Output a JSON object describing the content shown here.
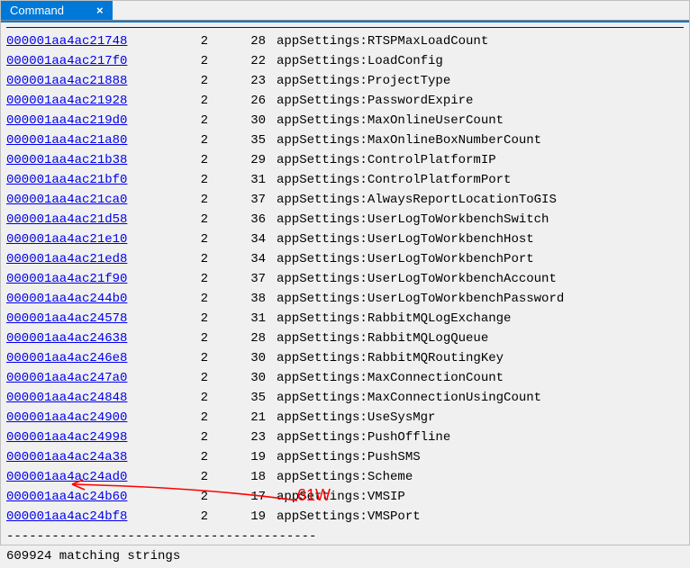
{
  "window": {
    "title": "Command"
  },
  "rows": [
    {
      "addr": "000001aa4ac21748",
      "ref": 2,
      "len": 28,
      "str": "appSettings:RTSPMaxLoadCount"
    },
    {
      "addr": "000001aa4ac217f0",
      "ref": 2,
      "len": 22,
      "str": "appSettings:LoadConfig"
    },
    {
      "addr": "000001aa4ac21888",
      "ref": 2,
      "len": 23,
      "str": "appSettings:ProjectType"
    },
    {
      "addr": "000001aa4ac21928",
      "ref": 2,
      "len": 26,
      "str": "appSettings:PasswordExpire"
    },
    {
      "addr": "000001aa4ac219d0",
      "ref": 2,
      "len": 30,
      "str": "appSettings:MaxOnlineUserCount"
    },
    {
      "addr": "000001aa4ac21a80",
      "ref": 2,
      "len": 35,
      "str": "appSettings:MaxOnlineBoxNumberCount"
    },
    {
      "addr": "000001aa4ac21b38",
      "ref": 2,
      "len": 29,
      "str": "appSettings:ControlPlatformIP"
    },
    {
      "addr": "000001aa4ac21bf0",
      "ref": 2,
      "len": 31,
      "str": "appSettings:ControlPlatformPort"
    },
    {
      "addr": "000001aa4ac21ca0",
      "ref": 2,
      "len": 37,
      "str": "appSettings:AlwaysReportLocationToGIS"
    },
    {
      "addr": "000001aa4ac21d58",
      "ref": 2,
      "len": 36,
      "str": "appSettings:UserLogToWorkbenchSwitch"
    },
    {
      "addr": "000001aa4ac21e10",
      "ref": 2,
      "len": 34,
      "str": "appSettings:UserLogToWorkbenchHost"
    },
    {
      "addr": "000001aa4ac21ed8",
      "ref": 2,
      "len": 34,
      "str": "appSettings:UserLogToWorkbenchPort"
    },
    {
      "addr": "000001aa4ac21f90",
      "ref": 2,
      "len": 37,
      "str": "appSettings:UserLogToWorkbenchAccount"
    },
    {
      "addr": "000001aa4ac244b0",
      "ref": 2,
      "len": 38,
      "str": "appSettings:UserLogToWorkbenchPassword"
    },
    {
      "addr": "000001aa4ac24578",
      "ref": 2,
      "len": 31,
      "str": "appSettings:RabbitMQLogExchange"
    },
    {
      "addr": "000001aa4ac24638",
      "ref": 2,
      "len": 28,
      "str": "appSettings:RabbitMQLogQueue"
    },
    {
      "addr": "000001aa4ac246e8",
      "ref": 2,
      "len": 30,
      "str": "appSettings:RabbitMQRoutingKey"
    },
    {
      "addr": "000001aa4ac247a0",
      "ref": 2,
      "len": 30,
      "str": "appSettings:MaxConnectionCount"
    },
    {
      "addr": "000001aa4ac24848",
      "ref": 2,
      "len": 35,
      "str": "appSettings:MaxConnectionUsingCount"
    },
    {
      "addr": "000001aa4ac24900",
      "ref": 2,
      "len": 21,
      "str": "appSettings:UseSysMgr"
    },
    {
      "addr": "000001aa4ac24998",
      "ref": 2,
      "len": 23,
      "str": "appSettings:PushOffline"
    },
    {
      "addr": "000001aa4ac24a38",
      "ref": 2,
      "len": 19,
      "str": "appSettings:PushSMS"
    },
    {
      "addr": "000001aa4ac24ad0",
      "ref": 2,
      "len": 18,
      "str": "appSettings:Scheme"
    },
    {
      "addr": "000001aa4ac24b60",
      "ref": 2,
      "len": 17,
      "str": "appSettings:VMSIP"
    },
    {
      "addr": "000001aa4ac24bf8",
      "ref": 2,
      "len": 19,
      "str": "appSettings:VMSPort"
    }
  ],
  "dash_line": "-----------------------------------------",
  "summary": "609924 matching strings",
  "annotation": {
    "text": "61W",
    "color": "#ff0000"
  }
}
